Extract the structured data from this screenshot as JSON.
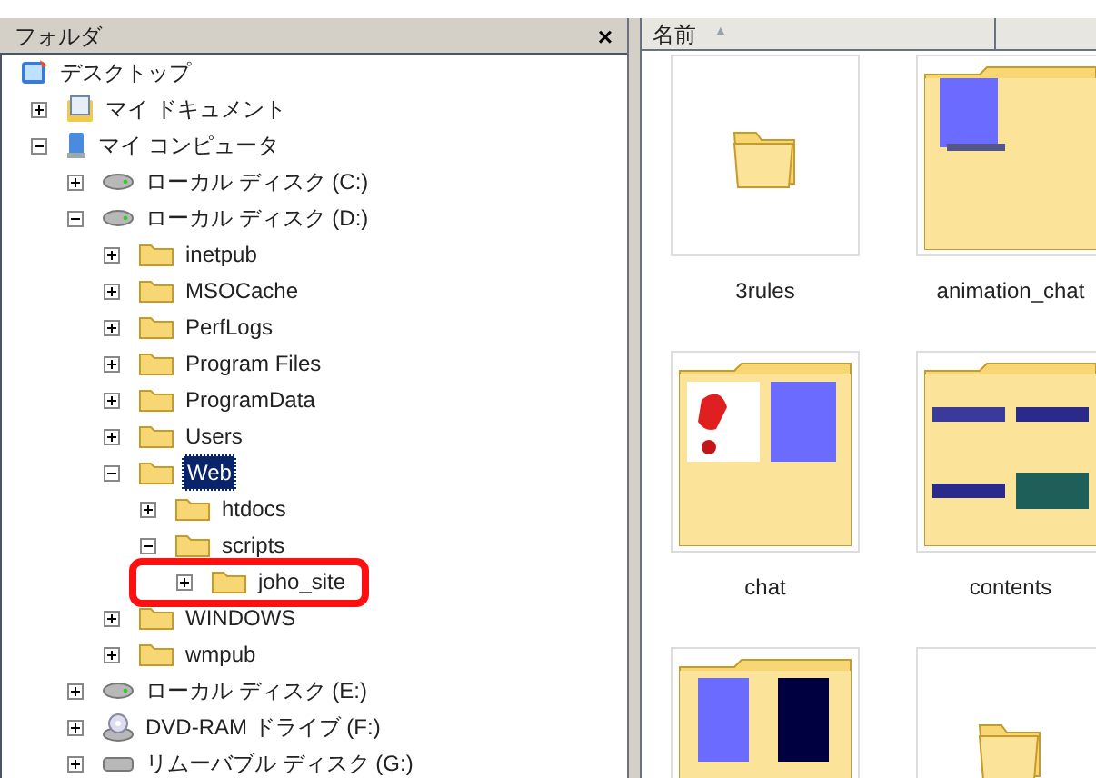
{
  "folder_pane": {
    "title": "フォルダ",
    "close": "×",
    "tree": [
      {
        "label": "デスクトップ",
        "kind": "desktop",
        "selected": false,
        "children": [
          {
            "label": "マイ ドキュメント",
            "kind": "documents",
            "expanded": false,
            "selected": false
          },
          {
            "label": "マイ コンピュータ",
            "kind": "computer",
            "expanded": true,
            "selected": false,
            "children": [
              {
                "label": "ローカル ディスク (C:)",
                "kind": "drive",
                "expanded": false,
                "selected": false
              },
              {
                "label": "ローカル ディスク (D:)",
                "kind": "drive",
                "expanded": true,
                "selected": false,
                "children": [
                  {
                    "label": "inetpub",
                    "kind": "folder",
                    "expanded": false,
                    "selected": false
                  },
                  {
                    "label": "MSOCache",
                    "kind": "folder",
                    "expanded": false,
                    "selected": false
                  },
                  {
                    "label": "PerfLogs",
                    "kind": "folder",
                    "expanded": false,
                    "selected": false
                  },
                  {
                    "label": "Program Files",
                    "kind": "folder",
                    "expanded": false,
                    "selected": false
                  },
                  {
                    "label": "ProgramData",
                    "kind": "folder",
                    "expanded": false,
                    "selected": false
                  },
                  {
                    "label": "Users",
                    "kind": "folder",
                    "expanded": false,
                    "selected": false
                  },
                  {
                    "label": "Web",
                    "kind": "folder",
                    "expanded": true,
                    "selected": true,
                    "children": [
                      {
                        "label": "htdocs",
                        "kind": "folder",
                        "expanded": false,
                        "selected": false
                      },
                      {
                        "label": "scripts",
                        "kind": "folder",
                        "expanded": true,
                        "selected": false,
                        "children": [
                          {
                            "label": "joho_site",
                            "kind": "folder",
                            "expanded": false,
                            "selected": false,
                            "highlighted": true
                          }
                        ]
                      }
                    ]
                  },
                  {
                    "label": "WINDOWS",
                    "kind": "folder",
                    "expanded": false,
                    "selected": false
                  },
                  {
                    "label": "wmpub",
                    "kind": "folder",
                    "expanded": false,
                    "selected": false
                  }
                ]
              },
              {
                "label": "ローカル ディスク (E:)",
                "kind": "drive",
                "expanded": false,
                "selected": false
              },
              {
                "label": "DVD-RAM ドライブ (F:)",
                "kind": "dvd",
                "expanded": false,
                "selected": false
              },
              {
                "label": "リムーバブル ディスク (G:)",
                "kind": "removable",
                "expanded": false,
                "selected": false
              }
            ]
          }
        ]
      }
    ]
  },
  "file_view": {
    "columns": [
      {
        "label": "名前",
        "sort": "▲"
      }
    ],
    "items": [
      {
        "name": "3rules",
        "kind": "plain"
      },
      {
        "name": "animation_chat",
        "kind": "preview"
      },
      {
        "name": "chat",
        "kind": "preview"
      },
      {
        "name": "contents",
        "kind": "preview"
      },
      {
        "kind": "preview"
      },
      {
        "kind": "plain"
      }
    ]
  }
}
